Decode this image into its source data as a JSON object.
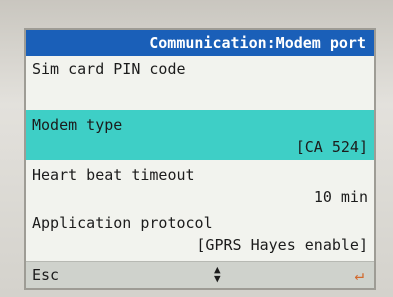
{
  "header": {
    "title": "Communication:Modem port"
  },
  "items": [
    {
      "label": "Sim card PIN code",
      "value": ""
    },
    {
      "label": "Modem type",
      "value": "[CA 524]"
    },
    {
      "label": "Heart beat timeout",
      "value": "10 min"
    },
    {
      "label": "Application protocol",
      "value": "[GPRS Hayes enable]"
    }
  ],
  "footer": {
    "esc_label": "Esc",
    "nav_icon": "up-down-arrows-icon",
    "enter_icon": "enter-return-icon"
  },
  "colors": {
    "header_bg": "#1a5fb8",
    "selected_bg": "#3ecfc6",
    "screen_bg": "#f2f3ee"
  }
}
